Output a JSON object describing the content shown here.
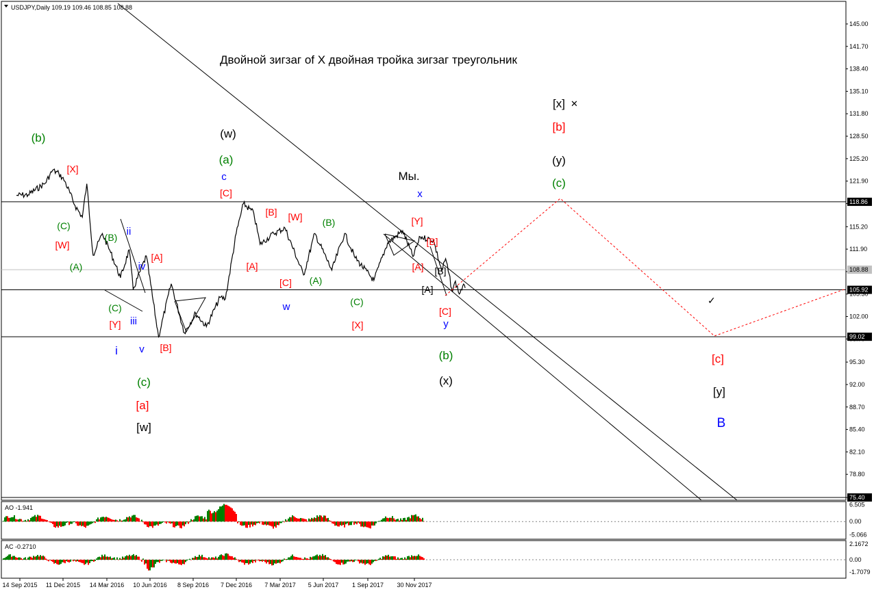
{
  "header": {
    "symbol_line": "USDJPY,Daily  109.19 109.46 108.85 108.88",
    "ao_label": "AO -1.941",
    "ac_label": "AC -0.2710"
  },
  "title_annotation": "Двойной зигзаг of X двойная тройка зигзаг треугольник",
  "colors": {
    "price": "#000000",
    "red": "#ff0000",
    "green": "#008000",
    "blue": "#0000ff",
    "black": "#000000",
    "grid_dash": "#808080",
    "projection": "#ff0000"
  },
  "chart_data": [
    {
      "type": "line",
      "name": "USDJPY Daily price (main panel)",
      "y_axis_ticks": [
        "145.00",
        "141.70",
        "138.40",
        "135.10",
        "131.80",
        "128.50",
        "125.20",
        "121.90",
        "118.60",
        "115.20",
        "111.90",
        "108.60",
        "105.30",
        "102.00",
        "98.70",
        "95.30",
        "92.00",
        "88.70",
        "85.40",
        "82.10",
        "78.80",
        "75.40"
      ],
      "ylim": [
        75.4,
        147.0
      ],
      "x_axis_dates": [
        "14 Sep 2015",
        "11 Dec 2015",
        "14 Mar 2016",
        "10 Jun 2016",
        "8 Sep 2016",
        "7 Dec 2016",
        "7 Mar 2017",
        "5 Jun 2017",
        "1 Sep 2017",
        "30 Nov 2017"
      ],
      "price_labels": [
        "118.86",
        "108.88",
        "105.92",
        "99.02",
        "75.40"
      ],
      "horizontal_levels": [
        118.86,
        105.92,
        99.02,
        75.4
      ],
      "current_price": 108.88,
      "anchor_points": [
        {
          "date": "2015-09-07",
          "price": 119.8
        },
        {
          "date": "2015-10-01",
          "price": 119.9
        },
        {
          "date": "2015-11-05",
          "price": 121.6
        },
        {
          "date": "2015-11-20",
          "price": 123.5
        },
        {
          "date": "2015-12-03",
          "price": 123.0
        },
        {
          "date": "2015-12-15",
          "price": 121.9
        },
        {
          "date": "2016-01-05",
          "price": 118.3
        },
        {
          "date": "2016-01-20",
          "price": 116.6
        },
        {
          "date": "2016-01-29",
          "price": 121.5
        },
        {
          "date": "2016-02-11",
          "price": 111.0
        },
        {
          "date": "2016-03-01",
          "price": 114.2
        },
        {
          "date": "2016-03-18",
          "price": 111.4
        },
        {
          "date": "2016-04-07",
          "price": 107.7
        },
        {
          "date": "2016-04-25",
          "price": 111.8
        },
        {
          "date": "2016-05-03",
          "price": 106.0
        },
        {
          "date": "2016-05-30",
          "price": 110.9
        },
        {
          "date": "2016-06-24",
          "price": 99.0
        },
        {
          "date": "2016-07-20",
          "price": 106.8
        },
        {
          "date": "2016-08-16",
          "price": 99.6
        },
        {
          "date": "2016-09-08",
          "price": 102.5
        },
        {
          "date": "2016-09-30",
          "price": 100.5
        },
        {
          "date": "2016-10-28",
          "price": 104.8
        },
        {
          "date": "2016-11-08",
          "price": 104.6
        },
        {
          "date": "2016-11-30",
          "price": 114.2
        },
        {
          "date": "2016-12-15",
          "price": 118.6
        },
        {
          "date": "2017-01-05",
          "price": 117.2
        },
        {
          "date": "2017-01-18",
          "price": 112.6
        },
        {
          "date": "2017-02-15",
          "price": 114.2
        },
        {
          "date": "2017-03-10",
          "price": 115.0
        },
        {
          "date": "2017-04-17",
          "price": 108.1
        },
        {
          "date": "2017-05-10",
          "price": 114.2
        },
        {
          "date": "2017-06-14",
          "price": 108.8
        },
        {
          "date": "2017-07-10",
          "price": 114.2
        },
        {
          "date": "2017-08-01",
          "price": 110.6
        },
        {
          "date": "2017-09-08",
          "price": 107.3
        },
        {
          "date": "2017-10-06",
          "price": 112.8
        },
        {
          "date": "2017-11-06",
          "price": 114.6
        },
        {
          "date": "2017-11-27",
          "price": 110.8
        },
        {
          "date": "2017-12-12",
          "price": 113.7
        },
        {
          "date": "2018-01-08",
          "price": 113.2
        },
        {
          "date": "2018-01-25",
          "price": 108.7
        },
        {
          "date": "2018-02-02",
          "price": 110.5
        },
        {
          "date": "2018-02-16",
          "price": 105.6
        },
        {
          "date": "2018-02-22",
          "price": 107.2
        },
        {
          "date": "2018-03-02",
          "price": 105.3
        },
        {
          "date": "2018-03-09",
          "price": 106.5
        },
        {
          "date": "2018-03-14",
          "price": 106.2
        }
      ]
    },
    {
      "type": "bar",
      "name": "AO -1.941",
      "y_axis_ticks": [
        "6.505",
        "0.00",
        "-5.066"
      ],
      "ylim": [
        -6.3,
        7.2
      ],
      "last_value": -1.941
    },
    {
      "type": "bar",
      "name": "AC -0.2710",
      "y_axis_ticks": [
        "2.1672",
        "0.00",
        "-1.7079"
      ],
      "ylim": [
        -2.35,
        2.45
      ],
      "last_value": -0.271
    }
  ],
  "wave_labels": [
    {
      "text": "(b)",
      "color": "green"
    },
    {
      "text": "[X]",
      "color": "red"
    },
    {
      "text": "(C)",
      "color": "green"
    },
    {
      "text": "[W]",
      "color": "red"
    },
    {
      "text": "(A)",
      "color": "green"
    },
    {
      "text": "(B)",
      "color": "green"
    },
    {
      "text": "ii",
      "color": "blue"
    },
    {
      "text": "iv",
      "color": "blue"
    },
    {
      "text": "[A]",
      "color": "red"
    },
    {
      "text": "(C)",
      "color": "green"
    },
    {
      "text": "[Y]",
      "color": "red"
    },
    {
      "text": "iii",
      "color": "blue"
    },
    {
      "text": "i",
      "color": "blue"
    },
    {
      "text": "v",
      "color": "blue"
    },
    {
      "text": "[B]",
      "color": "red"
    },
    {
      "text": "(c)",
      "color": "green"
    },
    {
      "text": "[a]",
      "color": "red"
    },
    {
      "text": "[w]",
      "color": "black"
    },
    {
      "text": "(w)",
      "color": "black"
    },
    {
      "text": "(a)",
      "color": "green"
    },
    {
      "text": "c",
      "color": "blue"
    },
    {
      "text": "[C]",
      "color": "red"
    },
    {
      "text": "[B]",
      "color": "red"
    },
    {
      "text": "[W]",
      "color": "red"
    },
    {
      "text": "[A]",
      "color": "red"
    },
    {
      "text": "[C]",
      "color": "red"
    },
    {
      "text": "w",
      "color": "blue"
    },
    {
      "text": "(B)",
      "color": "green"
    },
    {
      "text": "(A)",
      "color": "green"
    },
    {
      "text": "(C)",
      "color": "green"
    },
    {
      "text": "[X]",
      "color": "red"
    },
    {
      "text": "Мы.",
      "color": "black"
    },
    {
      "text": "x",
      "color": "blue"
    },
    {
      "text": "[Y]",
      "color": "red"
    },
    {
      "text": "[B]",
      "color": "red"
    },
    {
      "text": "[A]",
      "color": "red"
    },
    {
      "text": "[B]",
      "color": "black"
    },
    {
      "text": "[A]",
      "color": "black"
    },
    {
      "text": "[C]",
      "color": "red"
    },
    {
      "text": "y",
      "color": "blue"
    },
    {
      "text": "(b)",
      "color": "green"
    },
    {
      "text": "(x)",
      "color": "black"
    },
    {
      "text": "[x]",
      "color": "black"
    },
    {
      "text": "[b]",
      "color": "red"
    },
    {
      "text": "(y)",
      "color": "black"
    },
    {
      "text": "(c)",
      "color": "green"
    },
    {
      "text": "[c]",
      "color": "red"
    },
    {
      "text": "[y]",
      "color": "black"
    },
    {
      "text": "B",
      "color": "blue"
    }
  ]
}
